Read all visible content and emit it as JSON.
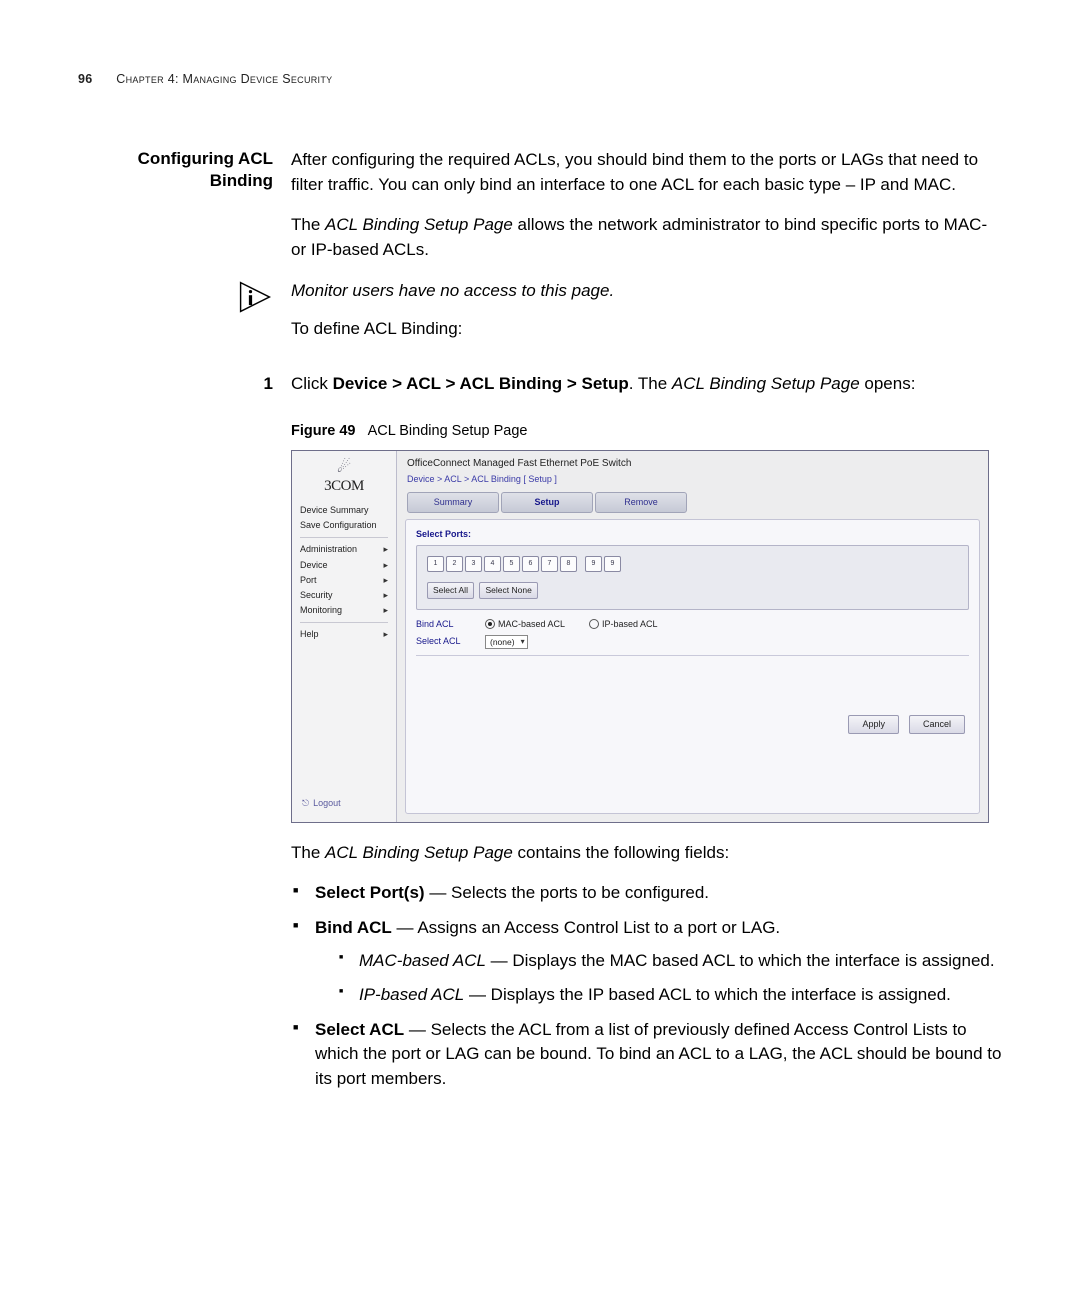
{
  "page_header": {
    "number": "96",
    "chapter": "Chapter 4: Managing Device Security"
  },
  "section_title": {
    "line1": "Configuring ACL",
    "line2": "Binding"
  },
  "intro_para": "After configuring the required ACLs, you should bind them to the ports or LAGs that need to filter traffic. You can only bind an interface to one ACL for each basic type – IP and MAC.",
  "para2_pre": "The ",
  "para2_em": "ACL Binding Setup Page",
  "para2_post": " allows the network administrator to bind specific ports to MAC- or IP-based ACLs.",
  "note_text": "Monitor users have no access to this page.",
  "define_line": "To define ACL Binding:",
  "step1": {
    "num": "1",
    "pre": "Click ",
    "bold": "Device > ACL > ACL Binding > Setup",
    "mid": ". The ",
    "em": "ACL Binding Setup Page",
    "post": " opens:"
  },
  "figure": {
    "label": "Figure 49",
    "caption": "ACL Binding Setup Page"
  },
  "screenshot": {
    "brand": "3COM",
    "product_title": "OfficeConnect Managed Fast Ethernet PoE Switch",
    "breadcrumb": "Device > ACL > ACL Binding [ Setup ]",
    "left_menu_top": [
      "Device Summary",
      "Save Configuration"
    ],
    "left_menu_main": [
      "Administration",
      "Device",
      "Port",
      "Security",
      "Monitoring"
    ],
    "left_menu_help": "Help",
    "logout": "Logout",
    "tabs": [
      "Summary",
      "Setup",
      "Remove"
    ],
    "active_tab": "Setup",
    "select_ports_label": "Select Ports:",
    "ports": [
      "1",
      "2",
      "3",
      "4",
      "5",
      "6",
      "7",
      "8",
      "9",
      "9"
    ],
    "select_all": "Select All",
    "select_none": "Select None",
    "bind_acl_label": "Bind ACL",
    "radio_mac": "MAC-based ACL",
    "radio_ip": "IP-based ACL",
    "select_acl_label": "Select ACL",
    "select_acl_value": "(none)",
    "apply": "Apply",
    "cancel": "Cancel"
  },
  "contains_line_pre": "The ",
  "contains_line_em": "ACL Binding Setup Page",
  "contains_line_post": " contains the following fields:",
  "bullets": {
    "b1_strong": "Select Port(s)",
    "b1_text": " — Selects the ports to be configured.",
    "b2_strong": "Bind ACL",
    "b2_text": " — Assigns an Access Control List to a port or LAG.",
    "b2a_em": "MAC-based ACL",
    "b2a_text": " — Displays the MAC based ACL to which the interface is assigned.",
    "b2b_em": "IP-based ACL",
    "b2b_text": " — Displays the IP based ACL to which the interface is assigned.",
    "b3_strong": "Select ACL",
    "b3_text": " — Selects the ACL from a list of previously defined Access Control Lists to which the port or LAG can be bound. To bind an ACL to a LAG, the ACL should be bound to its port members."
  }
}
